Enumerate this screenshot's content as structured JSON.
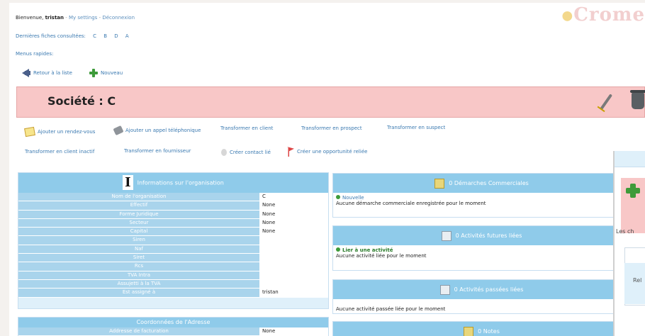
{
  "header": {
    "welcome_prefix": "Bienvenue, ",
    "user": "tristan",
    "settings_link": "My settings",
    "logout_link": "Déconnexion",
    "brand": "Crome"
  },
  "recent": {
    "label": "Dernières fiches consultées:",
    "items": [
      "C",
      "B",
      "D",
      "A"
    ]
  },
  "quick_menu": {
    "label": "Menus rapides:"
  },
  "nav": {
    "back_label": "Retour à la liste",
    "new_label": "Nouveau"
  },
  "title": {
    "text": "Société : C"
  },
  "actions": {
    "row1": [
      "Ajouter un rendez-vous",
      "Ajouter un appel téléphonique",
      "Transformer en client",
      "Transformer en prospect",
      "Transformer en suspect"
    ],
    "row2": [
      "Transformer en client inactif",
      "Transformer en fournisseur",
      "Créer contact lié",
      "Créer une opportunité reliée"
    ]
  },
  "org": {
    "title": "Informations sur l'organisation",
    "glyph": "I",
    "rows": [
      {
        "label": "Nom de l'organisation",
        "value": "C"
      },
      {
        "label": "Effectif",
        "value": "None"
      },
      {
        "label": "Forme Juridique",
        "value": "None"
      },
      {
        "label": "Secteur",
        "value": "None"
      },
      {
        "label": "Capital",
        "value": "None"
      },
      {
        "label": "Siren",
        "value": ""
      },
      {
        "label": "Naf",
        "value": ""
      },
      {
        "label": "Siret",
        "value": ""
      },
      {
        "label": "Rcs",
        "value": ""
      },
      {
        "label": "TVA Intra",
        "value": ""
      },
      {
        "label": "Assujetti à la TVA",
        "value": ""
      },
      {
        "label": "Est assigné à",
        "value": "tristan"
      }
    ]
  },
  "coords": {
    "title": "Coordonnées de l'Adresse",
    "row_label": "Addresse de facturation",
    "row_value": "None"
  },
  "side": {
    "opps": {
      "title": "0 Démarches Commerciales",
      "new_label": "Nouvelle",
      "empty": "Aucune démarche commerciale enregistrée pour le moment"
    },
    "future": {
      "title": "0 Activités futures liées",
      "link_label": "Lier à une activité",
      "empty": "Aucune activité liée pour le moment"
    },
    "past": {
      "title": "0 Activités passées liées",
      "empty": "Aucune activité passée liée pour le moment"
    },
    "notes": {
      "title": "0 Notes"
    }
  },
  "overlay": {
    "text": "Les ch",
    "rel": "Rel"
  }
}
